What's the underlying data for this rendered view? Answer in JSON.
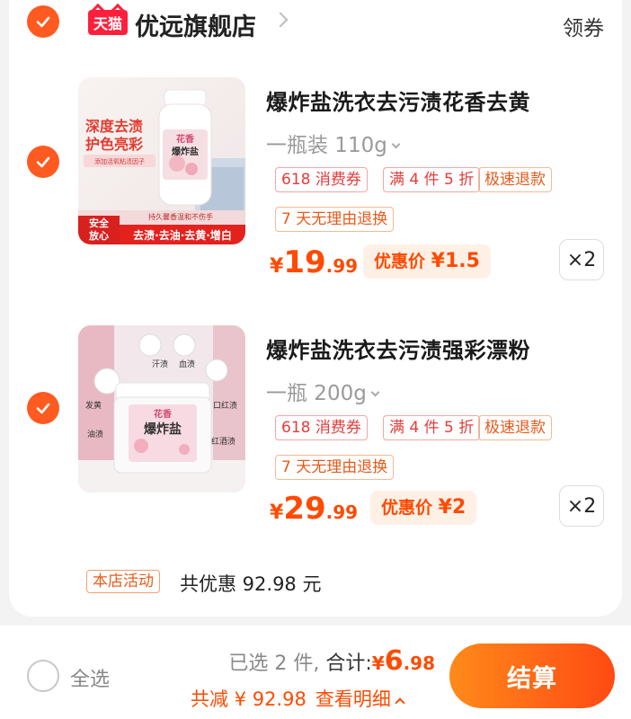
{
  "shop": {
    "logo_text": "天猫",
    "name": "优远旗舰店",
    "coupon_label": "领券"
  },
  "items": [
    {
      "title": "爆炸盐洗衣去污渍花香去黄",
      "spec": "一瓶装 110g",
      "tags": [
        "618  消费券",
        "满 4 件 5 折",
        "极速退款",
        "7 天无理由退换"
      ],
      "price": {
        "currency": "¥",
        "int": "19",
        "dec": ".99"
      },
      "promo": {
        "label": "优惠价",
        "currency": "¥",
        "value": "1.5"
      },
      "qty": "×2",
      "image_text": {
        "headline1": "深度去渍",
        "headline2": "护色亮彩",
        "sub": "添加活氧粘渍因子",
        "bottle_label1": "花香",
        "bottle_label2": "爆炸盐",
        "safe1": "安全",
        "safe2": "放心",
        "bar_top": "持久馨香温和不伤手",
        "bar_main": "去渍·去油·去黄·增白"
      }
    },
    {
      "title": "爆炸盐洗衣去污渍强彩漂粉",
      "spec": "一瓶 200g",
      "tags": [
        "618  消费券",
        "满 4 件 5 折",
        "极速退款",
        "7 天无理由退换"
      ],
      "price": {
        "currency": "¥",
        "int": "29",
        "dec": ".99"
      },
      "promo": {
        "label": "优惠价",
        "currency": "¥",
        "value": "2"
      },
      "qty": "×2",
      "image_text": {
        "tub_label1": "花香",
        "tub_label2": "爆炸盐",
        "stain1": "汗渍",
        "stain2": "血渍",
        "stain3": "发黄",
        "stain4": "口红渍",
        "stain5": "油渍",
        "stain6": "红酒渍"
      }
    }
  ],
  "activity": {
    "badge": "本店活动",
    "text": "共优惠 92.98 元"
  },
  "footer": {
    "select_all": "全选",
    "selected": "已选 2 件,",
    "total_label": "合计:",
    "total": {
      "currency": "¥",
      "int": "6",
      "dec": ".98"
    },
    "discount_label": "共减 ¥ 92.98",
    "detail_label": "查看明细",
    "checkout": "结算"
  },
  "colors": {
    "accent": "#ff4a00",
    "check": "#ff5a1f",
    "tmall_red": "#ff1f3d"
  }
}
